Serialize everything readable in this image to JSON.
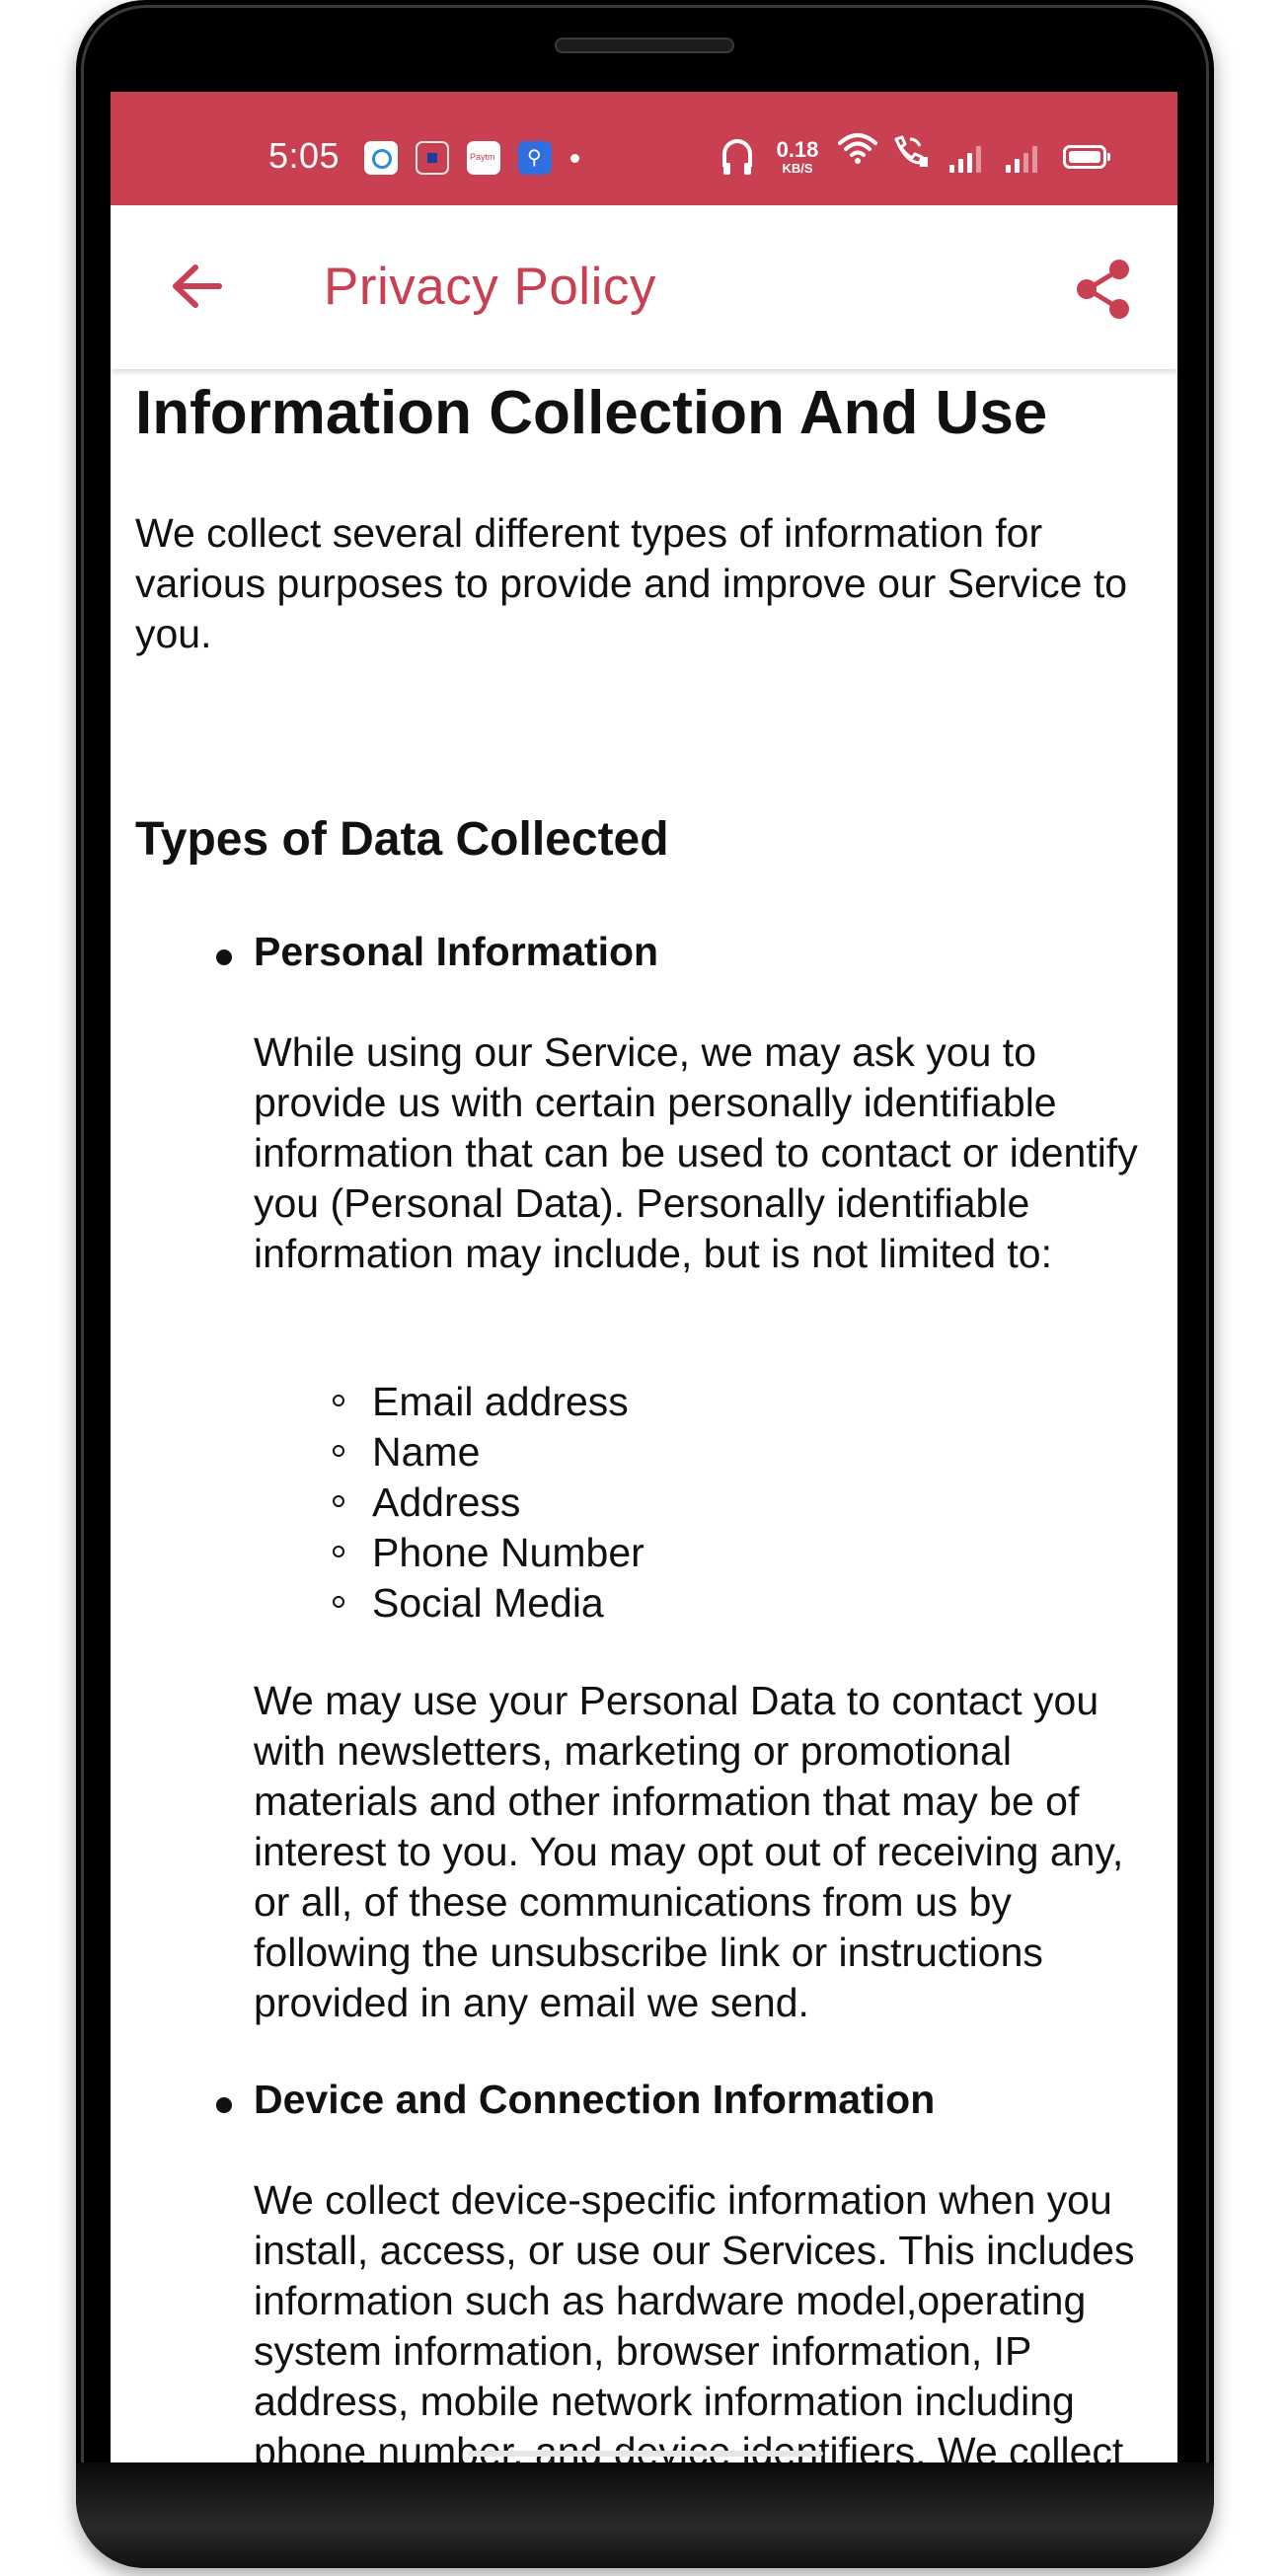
{
  "status_bar": {
    "time": "5:05",
    "net_speed_value": "0.18",
    "net_speed_unit": "KB/S",
    "background_color": "#c94052",
    "icons": [
      "notification-app-icon",
      "notification-square-icon",
      "paytm-icon",
      "usb-icon",
      "dot-icon",
      "headphone-icon",
      "wifi-icon",
      "wifi-calling-icon",
      "signal-icon",
      "signal-icon",
      "battery-icon"
    ]
  },
  "app_bar": {
    "title": "Privacy Policy",
    "accent_color": "#c94052",
    "back_icon": "arrow-left-icon",
    "share_icon": "share-icon"
  },
  "content": {
    "heading": "Information Collection And Use",
    "intro": "We collect several different types of information for various purposes to provide and improve our Service to you.",
    "subheading": "Types of Data Collected",
    "items": [
      {
        "title": "Personal Information",
        "body": "While using our Service, we may ask you to provide us with certain personally identifiable information that can be used to contact or identify you (Personal Data). Personally identifiable information may include, but is not limited to:",
        "list": [
          "Email address",
          "Name",
          "Address",
          "Phone Number",
          "Social Media"
        ],
        "after": "We may use your Personal Data to contact you with newsletters, marketing or promotional materials and other information that may be of interest to you. You may opt out of receiving any, or all, of these communications from us by following the unsubscribe link or instructions provided in any email we send."
      },
      {
        "title": "Device and Connection Information",
        "body": "We collect device-specific information when you install, access, or use our Services. This includes information such as hardware model,operating system information, browser information, IP address, mobile network information including phone number, and device identifiers. We collect device"
      }
    ]
  }
}
